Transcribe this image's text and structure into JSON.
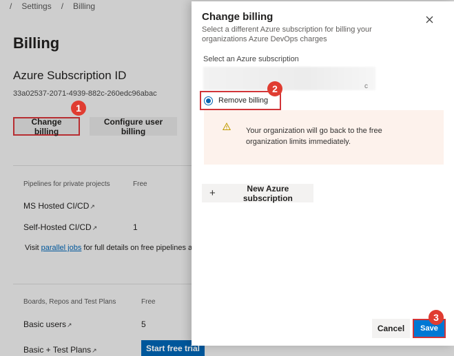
{
  "breadcrumb": [
    "/",
    "Settings",
    "/",
    "Billing"
  ],
  "background": {
    "title": "Billing",
    "subscription_heading": "Azure Subscription ID",
    "subscription_id": "33a02537-2071-4939-882c-260edc96abac",
    "change_billing_label": "Change billing",
    "configure_billing_label": "Configure user billing",
    "pipelines_header": "Pipelines for private projects",
    "pipelines_free": "Free",
    "ms_hosted": "MS Hosted CI/CD",
    "self_hosted": "Self-Hosted CI/CD",
    "self_hosted_value": "1",
    "visit_prefix": "Visit ",
    "parallel_jobs_link": "parallel jobs",
    "visit_suffix": " for full details on free pipelines a",
    "boards_header": "Boards, Repos and Test Plans",
    "boards_free": "Free",
    "basic_users": "Basic users",
    "basic_users_value": "5",
    "basic_test_plans": "Basic + Test Plans",
    "start_trial_label": "Start free trial"
  },
  "panel": {
    "title": "Change billing",
    "description": "Select a different Azure subscription for billing your organizations Azure DevOps charges",
    "select_label": "Select an Azure subscription",
    "blur_fragment": "c",
    "remove_billing_label": "Remove billing",
    "warning_text": "Your organization will go back to the free organization limits immediately.",
    "new_subscription_label": "New Azure subscription",
    "cancel_label": "Cancel",
    "save_label": "Save"
  },
  "callouts": [
    "1",
    "2",
    "3"
  ],
  "colors": {
    "accent": "#0078d4",
    "highlight": "#d13438",
    "callout": "#e03c31",
    "warning_bg": "#fdf2ec",
    "warning_icon": "#c19c00"
  }
}
